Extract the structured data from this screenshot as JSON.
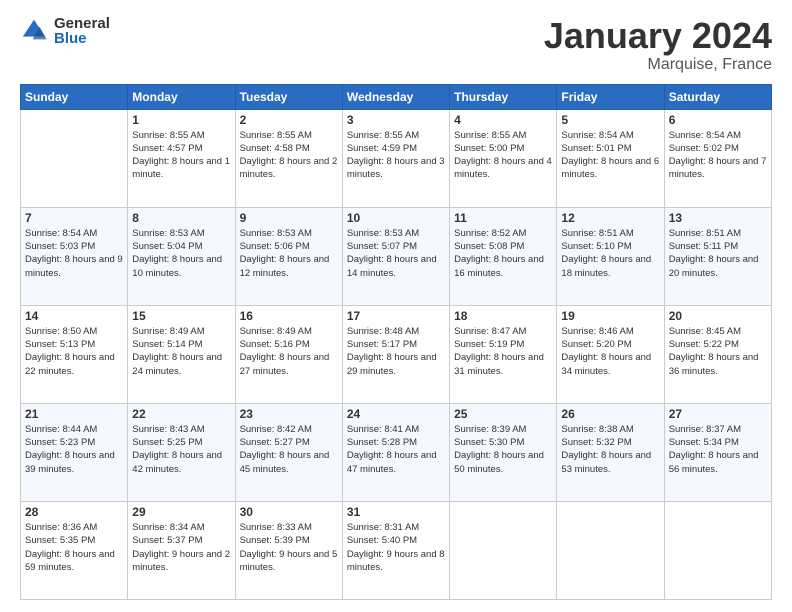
{
  "logo": {
    "general": "General",
    "blue": "Blue"
  },
  "header": {
    "month": "January 2024",
    "location": "Marquise, France"
  },
  "weekdays": [
    "Sunday",
    "Monday",
    "Tuesday",
    "Wednesday",
    "Thursday",
    "Friday",
    "Saturday"
  ],
  "weeks": [
    [
      {
        "day": "",
        "sunrise": "",
        "sunset": "",
        "daylight": ""
      },
      {
        "day": "1",
        "sunrise": "Sunrise: 8:55 AM",
        "sunset": "Sunset: 4:57 PM",
        "daylight": "Daylight: 8 hours and 1 minute."
      },
      {
        "day": "2",
        "sunrise": "Sunrise: 8:55 AM",
        "sunset": "Sunset: 4:58 PM",
        "daylight": "Daylight: 8 hours and 2 minutes."
      },
      {
        "day": "3",
        "sunrise": "Sunrise: 8:55 AM",
        "sunset": "Sunset: 4:59 PM",
        "daylight": "Daylight: 8 hours and 3 minutes."
      },
      {
        "day": "4",
        "sunrise": "Sunrise: 8:55 AM",
        "sunset": "Sunset: 5:00 PM",
        "daylight": "Daylight: 8 hours and 4 minutes."
      },
      {
        "day": "5",
        "sunrise": "Sunrise: 8:54 AM",
        "sunset": "Sunset: 5:01 PM",
        "daylight": "Daylight: 8 hours and 6 minutes."
      },
      {
        "day": "6",
        "sunrise": "Sunrise: 8:54 AM",
        "sunset": "Sunset: 5:02 PM",
        "daylight": "Daylight: 8 hours and 7 minutes."
      }
    ],
    [
      {
        "day": "7",
        "sunrise": "Sunrise: 8:54 AM",
        "sunset": "Sunset: 5:03 PM",
        "daylight": "Daylight: 8 hours and 9 minutes."
      },
      {
        "day": "8",
        "sunrise": "Sunrise: 8:53 AM",
        "sunset": "Sunset: 5:04 PM",
        "daylight": "Daylight: 8 hours and 10 minutes."
      },
      {
        "day": "9",
        "sunrise": "Sunrise: 8:53 AM",
        "sunset": "Sunset: 5:06 PM",
        "daylight": "Daylight: 8 hours and 12 minutes."
      },
      {
        "day": "10",
        "sunrise": "Sunrise: 8:53 AM",
        "sunset": "Sunset: 5:07 PM",
        "daylight": "Daylight: 8 hours and 14 minutes."
      },
      {
        "day": "11",
        "sunrise": "Sunrise: 8:52 AM",
        "sunset": "Sunset: 5:08 PM",
        "daylight": "Daylight: 8 hours and 16 minutes."
      },
      {
        "day": "12",
        "sunrise": "Sunrise: 8:51 AM",
        "sunset": "Sunset: 5:10 PM",
        "daylight": "Daylight: 8 hours and 18 minutes."
      },
      {
        "day": "13",
        "sunrise": "Sunrise: 8:51 AM",
        "sunset": "Sunset: 5:11 PM",
        "daylight": "Daylight: 8 hours and 20 minutes."
      }
    ],
    [
      {
        "day": "14",
        "sunrise": "Sunrise: 8:50 AM",
        "sunset": "Sunset: 5:13 PM",
        "daylight": "Daylight: 8 hours and 22 minutes."
      },
      {
        "day": "15",
        "sunrise": "Sunrise: 8:49 AM",
        "sunset": "Sunset: 5:14 PM",
        "daylight": "Daylight: 8 hours and 24 minutes."
      },
      {
        "day": "16",
        "sunrise": "Sunrise: 8:49 AM",
        "sunset": "Sunset: 5:16 PM",
        "daylight": "Daylight: 8 hours and 27 minutes."
      },
      {
        "day": "17",
        "sunrise": "Sunrise: 8:48 AM",
        "sunset": "Sunset: 5:17 PM",
        "daylight": "Daylight: 8 hours and 29 minutes."
      },
      {
        "day": "18",
        "sunrise": "Sunrise: 8:47 AM",
        "sunset": "Sunset: 5:19 PM",
        "daylight": "Daylight: 8 hours and 31 minutes."
      },
      {
        "day": "19",
        "sunrise": "Sunrise: 8:46 AM",
        "sunset": "Sunset: 5:20 PM",
        "daylight": "Daylight: 8 hours and 34 minutes."
      },
      {
        "day": "20",
        "sunrise": "Sunrise: 8:45 AM",
        "sunset": "Sunset: 5:22 PM",
        "daylight": "Daylight: 8 hours and 36 minutes."
      }
    ],
    [
      {
        "day": "21",
        "sunrise": "Sunrise: 8:44 AM",
        "sunset": "Sunset: 5:23 PM",
        "daylight": "Daylight: 8 hours and 39 minutes."
      },
      {
        "day": "22",
        "sunrise": "Sunrise: 8:43 AM",
        "sunset": "Sunset: 5:25 PM",
        "daylight": "Daylight: 8 hours and 42 minutes."
      },
      {
        "day": "23",
        "sunrise": "Sunrise: 8:42 AM",
        "sunset": "Sunset: 5:27 PM",
        "daylight": "Daylight: 8 hours and 45 minutes."
      },
      {
        "day": "24",
        "sunrise": "Sunrise: 8:41 AM",
        "sunset": "Sunset: 5:28 PM",
        "daylight": "Daylight: 8 hours and 47 minutes."
      },
      {
        "day": "25",
        "sunrise": "Sunrise: 8:39 AM",
        "sunset": "Sunset: 5:30 PM",
        "daylight": "Daylight: 8 hours and 50 minutes."
      },
      {
        "day": "26",
        "sunrise": "Sunrise: 8:38 AM",
        "sunset": "Sunset: 5:32 PM",
        "daylight": "Daylight: 8 hours and 53 minutes."
      },
      {
        "day": "27",
        "sunrise": "Sunrise: 8:37 AM",
        "sunset": "Sunset: 5:34 PM",
        "daylight": "Daylight: 8 hours and 56 minutes."
      }
    ],
    [
      {
        "day": "28",
        "sunrise": "Sunrise: 8:36 AM",
        "sunset": "Sunset: 5:35 PM",
        "daylight": "Daylight: 8 hours and 59 minutes."
      },
      {
        "day": "29",
        "sunrise": "Sunrise: 8:34 AM",
        "sunset": "Sunset: 5:37 PM",
        "daylight": "Daylight: 9 hours and 2 minutes."
      },
      {
        "day": "30",
        "sunrise": "Sunrise: 8:33 AM",
        "sunset": "Sunset: 5:39 PM",
        "daylight": "Daylight: 9 hours and 5 minutes."
      },
      {
        "day": "31",
        "sunrise": "Sunrise: 8:31 AM",
        "sunset": "Sunset: 5:40 PM",
        "daylight": "Daylight: 9 hours and 8 minutes."
      },
      {
        "day": "",
        "sunrise": "",
        "sunset": "",
        "daylight": ""
      },
      {
        "day": "",
        "sunrise": "",
        "sunset": "",
        "daylight": ""
      },
      {
        "day": "",
        "sunrise": "",
        "sunset": "",
        "daylight": ""
      }
    ]
  ]
}
